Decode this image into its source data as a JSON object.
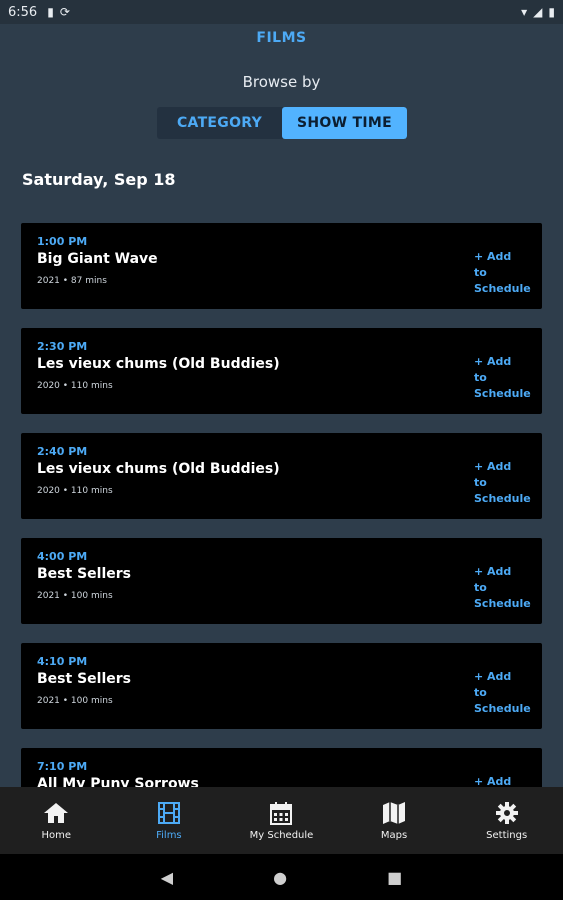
{
  "status_bar": {
    "time": "6:56",
    "icons": [
      "sd-card-icon",
      "sync-icon",
      "wifi-icon",
      "signal-icon",
      "battery-icon"
    ]
  },
  "header": {
    "title": "FILMS"
  },
  "browse": {
    "label": "Browse by",
    "options": [
      "CATEGORY",
      "SHOW TIME"
    ],
    "selected": "SHOW TIME"
  },
  "date_heading": "Saturday, Sep 18",
  "films": [
    {
      "time": "1:00 PM",
      "title": "Big Giant Wave",
      "meta": "2021 • 87 mins",
      "action": "+ Add to Schedule"
    },
    {
      "time": "2:30 PM",
      "title": "Les vieux chums (Old Buddies)",
      "meta": "2020 • 110 mins",
      "action": "+ Add to Schedule"
    },
    {
      "time": "2:40 PM",
      "title": "Les vieux chums (Old Buddies)",
      "meta": "2020 • 110 mins",
      "action": "+ Add to Schedule"
    },
    {
      "time": "4:00 PM",
      "title": "Best Sellers",
      "meta": "2021 • 100 mins",
      "action": "+ Add to Schedule"
    },
    {
      "time": "4:10 PM",
      "title": "Best Sellers",
      "meta": "2021 • 100 mins",
      "action": "+ Add to Schedule"
    },
    {
      "time": "7:10 PM",
      "title": "All My Puny Sorrows",
      "meta": "",
      "action": "+ Add to Schedule"
    }
  ],
  "bottom_nav": {
    "items": [
      {
        "label": "Home",
        "icon": "home-icon"
      },
      {
        "label": "Films",
        "icon": "film-icon"
      },
      {
        "label": "My Schedule",
        "icon": "calendar-icon"
      },
      {
        "label": "Maps",
        "icon": "map-icon"
      },
      {
        "label": "Settings",
        "icon": "gear-icon"
      }
    ],
    "active": "Films"
  },
  "colors": {
    "background": "#2e3d4b",
    "accent": "#4daaf5",
    "active_segment": "#52b3ff",
    "card": "#000000",
    "nav_bar": "#1f1f1f"
  }
}
